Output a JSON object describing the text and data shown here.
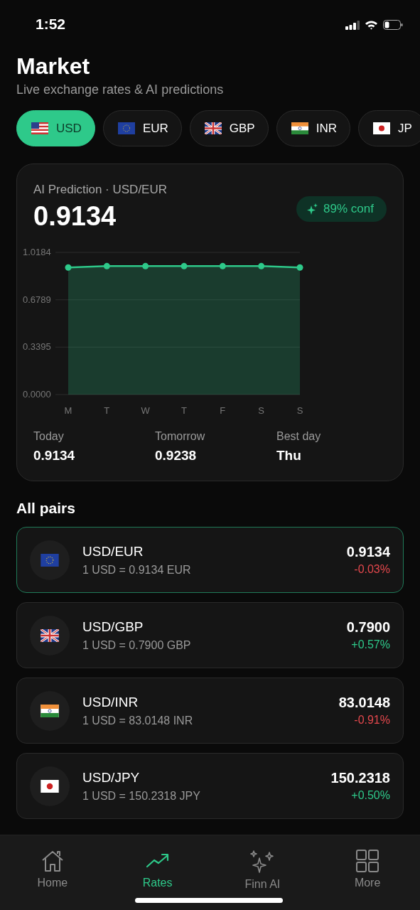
{
  "status_bar": {
    "time": "1:52"
  },
  "header": {
    "title": "Market",
    "subtitle": "Live exchange rates & AI predictions"
  },
  "currencies": [
    {
      "code": "USD",
      "kind": "us",
      "selected": true
    },
    {
      "code": "EUR",
      "kind": "eu",
      "selected": false
    },
    {
      "code": "GBP",
      "kind": "uk",
      "selected": false
    },
    {
      "code": "INR",
      "kind": "in",
      "selected": false
    },
    {
      "code": "JP",
      "kind": "jp",
      "selected": false
    }
  ],
  "prediction": {
    "label": "AI Prediction · USD/EUR",
    "value": "0.9134",
    "confidence": "89% conf",
    "chart_data": {
      "type": "area",
      "categories": [
        "M",
        "T",
        "W",
        "T",
        "F",
        "S",
        "S"
      ],
      "series": [
        {
          "color": "#2ec98a",
          "values": [
            0.91,
            0.92,
            0.92,
            0.92,
            0.92,
            0.92,
            0.91
          ]
        }
      ],
      "ylim": [
        0,
        1.0184
      ],
      "yticks": [
        {
          "value": 1.0184,
          "label": "1.0184"
        },
        {
          "value": 0.6789,
          "label": "0.6789"
        },
        {
          "value": 0.3395,
          "label": "0.3395"
        },
        {
          "value": 0,
          "label": "0.0000"
        }
      ]
    },
    "stats": [
      {
        "label": "Today",
        "value": "0.9134"
      },
      {
        "label": "Tomorrow",
        "value": "0.9238"
      },
      {
        "label": "Best day",
        "value": "Thu"
      }
    ]
  },
  "pairs_title": "All pairs",
  "pairs": [
    {
      "kind": "eu",
      "name": "USD/EUR",
      "detail": "1 USD = 0.9134 EUR",
      "rate": "0.9134",
      "change": "-0.03%",
      "color": "#e5484d",
      "selected": true
    },
    {
      "kind": "uk",
      "name": "USD/GBP",
      "detail": "1 USD = 0.7900 GBP",
      "rate": "0.7900",
      "change": "+0.57%",
      "color": "#2ec98a",
      "selected": false
    },
    {
      "kind": "in",
      "name": "USD/INR",
      "detail": "1 USD = 83.0148 INR",
      "rate": "83.0148",
      "change": "-0.91%",
      "color": "#e5484d",
      "selected": false
    },
    {
      "kind": "jp",
      "name": "USD/JPY",
      "detail": "1 USD = 150.2318 JPY",
      "rate": "150.2318",
      "change": "+0.50%",
      "color": "#2ec98a",
      "selected": false
    }
  ],
  "nav": [
    {
      "label": "Home",
      "kind": "home",
      "selected": false
    },
    {
      "label": "Rates",
      "kind": "rates",
      "selected": true
    },
    {
      "label": "Finn AI",
      "kind": "ai",
      "selected": false
    },
    {
      "label": "More",
      "kind": "more",
      "selected": false
    }
  ]
}
